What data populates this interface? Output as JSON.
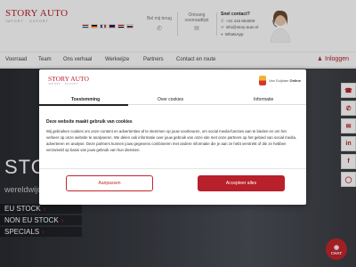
{
  "brand": {
    "name": "STORY AUTO",
    "tagline": "IMPORT · EXPORT"
  },
  "header": {
    "flags": [
      "nl",
      "de",
      "fr",
      "gb",
      "eg",
      "ru"
    ],
    "callback_label": "Bel mij terug",
    "appointment_label": [
      "Ontvang",
      "voorraadlijst"
    ],
    "contact_title": "Snel contact?",
    "phone": "+31 416 654000",
    "email": "info@story-auto.nl",
    "whatsapp": "WhatsApp"
  },
  "nav": {
    "items": [
      "Voorraad",
      "Team",
      "Ons verhaal",
      "Werkwijze",
      "Partners",
      "Contact en route"
    ],
    "login": "Inloggen"
  },
  "hero": {
    "headline": "STOCK",
    "sub": "wereldwijd",
    "links": [
      "EU STOCK",
      "NON EU STOCK",
      "SPECIALS"
    ]
  },
  "social": [
    "whatsapp",
    "phone",
    "mail",
    "linkedin",
    "facebook",
    "instagram"
  ],
  "chat_label": "CHAT",
  "cookie": {
    "provider_prefix": "Van Suijdam",
    "provider_suffix": "Online",
    "tabs": [
      "Toestemming",
      "Over cookies",
      "Informatie"
    ],
    "title": "Deze website maakt gebruik van cookies",
    "body": "Wij gebruiken cookies om onze content en advertenties af te stemmen op jouw voorkeuren, om social media-functies aan te bieden en om het verkeer op onze website te analyseren. We delen ook informatie over jouw gebruik van onze site met onze partners op het gebied van social media, adverteren en analyse. Deze partners kunnen jouw gegevens combineren met andere informatie die je aan ze hebt verstrekt of die ze hebben verzameld op basis van jouw gebruik van hun diensten.",
    "customize": "Aanpassen",
    "accept": "Accepteer alles"
  }
}
